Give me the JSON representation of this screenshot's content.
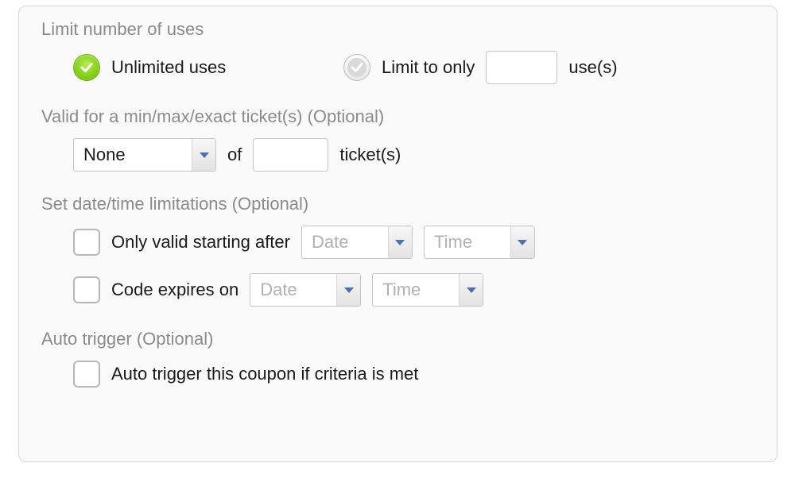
{
  "limitUses": {
    "title": "Limit number of uses",
    "unlimitedLabel": "Unlimited uses",
    "limitToOnlyLabel": "Limit to only",
    "usesSuffix": "use(s)",
    "usesValue": ""
  },
  "validFor": {
    "title": "Valid for a min/max/exact ticket(s) (Optional)",
    "selectValue": "None",
    "ofLabel": "of",
    "countValue": "",
    "ticketsSuffix": "ticket(s)"
  },
  "dateTime": {
    "title": "Set date/time limitations (Optional)",
    "startLabel": "Only valid starting after",
    "expiresLabel": "Code expires on",
    "datePlaceholder": "Date",
    "timePlaceholder": "Time"
  },
  "autoTrigger": {
    "title": "Auto trigger (Optional)",
    "label": "Auto trigger this coupon if criteria is met"
  }
}
